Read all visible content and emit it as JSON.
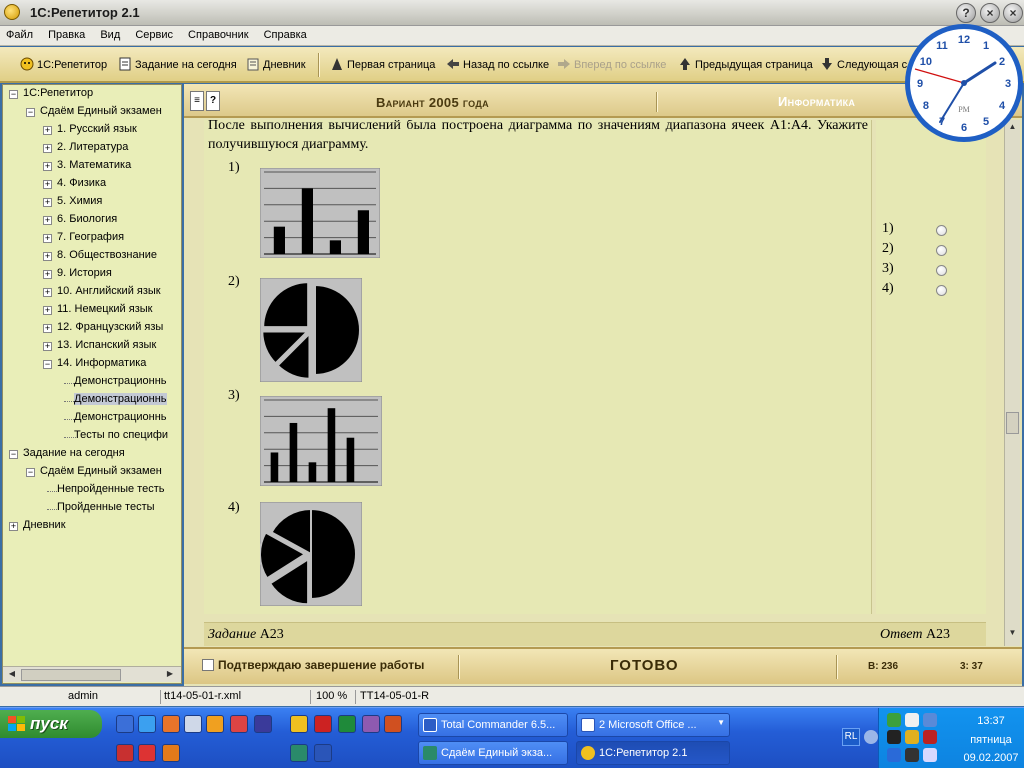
{
  "window": {
    "title": "1С:Репетитор 2.1",
    "controls": [
      "?",
      "×",
      "×"
    ]
  },
  "menu": [
    "Файл",
    "Правка",
    "Вид",
    "Сервис",
    "Справочник",
    "Справка"
  ],
  "toolbar": {
    "home": "1С:Репетитор",
    "today": "Задание на сегодня",
    "diary": "Дневник",
    "first_page": "Первая страница",
    "back_link": "Назад по ссылке",
    "forward_link": "Вперед по ссылке",
    "prev_page": "Предыдущая страница",
    "next_page": "Следующая с"
  },
  "tree": [
    {
      "label": "1С:Репетитор",
      "pm": "−"
    },
    {
      "label": "Сдаём Единый экзамен",
      "pm": "−"
    },
    {
      "label": "1. Русский язык",
      "pm": "+"
    },
    {
      "label": "2. Литература",
      "pm": "+"
    },
    {
      "label": "3. Математика",
      "pm": "+"
    },
    {
      "label": "4. Физика",
      "pm": "+"
    },
    {
      "label": "5. Химия",
      "pm": "+"
    },
    {
      "label": "6. Биология",
      "pm": "+"
    },
    {
      "label": "7. География",
      "pm": "+"
    },
    {
      "label": "8. Обществознание",
      "pm": "+"
    },
    {
      "label": "9. История",
      "pm": "+"
    },
    {
      "label": "10. Английский язык",
      "pm": "+"
    },
    {
      "label": "11. Немецкий язык",
      "pm": "+"
    },
    {
      "label": "12. Французский язы",
      "pm": "+"
    },
    {
      "label": "13. Испанский язык",
      "pm": "+"
    },
    {
      "label": "14. Информатика",
      "pm": "−"
    },
    {
      "label": "Демонстрационнь",
      "pm": ""
    },
    {
      "label": "Демонстрационнь",
      "pm": ""
    },
    {
      "label": "Демонстрационнь",
      "pm": ""
    },
    {
      "label": "Тесты по специфи",
      "pm": ""
    },
    {
      "label": "Задание на сегодня",
      "pm": "−"
    },
    {
      "label": "Сдаём Единый экзамен",
      "pm": "−"
    },
    {
      "label": "Непройденные тесть",
      "pm": ""
    },
    {
      "label": "Пройденные тесты",
      "pm": ""
    },
    {
      "label": "Дневник",
      "pm": "+"
    }
  ],
  "header": {
    "menu_btn": "≡",
    "help_btn": "?",
    "variant": "Вариант 2005 года",
    "subject": "Информатика"
  },
  "question": {
    "text": "После выполнения вычислений была построена диаграмма по значениям диапазона ячеек A1:A4. Укажите получившуюся диаграмму.",
    "options": [
      "1)",
      "2)",
      "3)",
      "4)"
    ]
  },
  "answers": [
    "1)",
    "2)",
    "3)",
    "4)"
  ],
  "footer": {
    "task_label": "Задание",
    "task_code": "А23",
    "answer_label": "Ответ",
    "answer_code": "А23"
  },
  "status_panel": {
    "confirm": "Подтверждаю завершение работы",
    "ready": "ГОТОВО",
    "b_count": "В: 236",
    "time": "3: 37"
  },
  "statusbar": {
    "user": "admin",
    "file": "tt14-05-01-r.xml",
    "zoom": "100 %",
    "code": "TT14-05-01-R"
  },
  "taskbar": {
    "start": "пуск",
    "tasks": [
      "Total Commander 6.5...",
      "2 Microsoft Office ...",
      "Сдаём Единый экза...",
      "1С:Репетитор 2.1"
    ],
    "lang": "RL",
    "clock_time": "13:37",
    "clock_day": "пятница",
    "clock_date": "09.02.2007"
  },
  "analog_clock": {
    "numbers": [
      "12",
      "1",
      "2",
      "3",
      "4",
      "5",
      "6",
      "7",
      "8",
      "9",
      "10",
      "11"
    ],
    "ampm": "PM"
  },
  "chart_data": [
    {
      "type": "bar",
      "categories": [
        "1",
        "2",
        "3",
        "4"
      ],
      "values": [
        2,
        4.8,
        1,
        3.2
      ],
      "ylim": [
        0,
        6
      ],
      "grid": true
    },
    {
      "type": "pie",
      "values": [
        50,
        12.5,
        12.5,
        25
      ],
      "note": "one slice exploded"
    },
    {
      "type": "bar",
      "categories": [
        "1",
        "2",
        "3",
        "4",
        "5",
        "6"
      ],
      "values": [
        1.8,
        3.6,
        1.2,
        4.5,
        2.7,
        0
      ],
      "ylim": [
        0,
        5
      ],
      "grid": true
    },
    {
      "type": "pie",
      "values": [
        50,
        16,
        17,
        17
      ],
      "note": "slices exploded"
    }
  ],
  "colors": {
    "toolbar": "#e8d99a",
    "panel": "#e6e8b4",
    "tree": "#e9eeb8",
    "clock_face": "#1f5fc4"
  }
}
